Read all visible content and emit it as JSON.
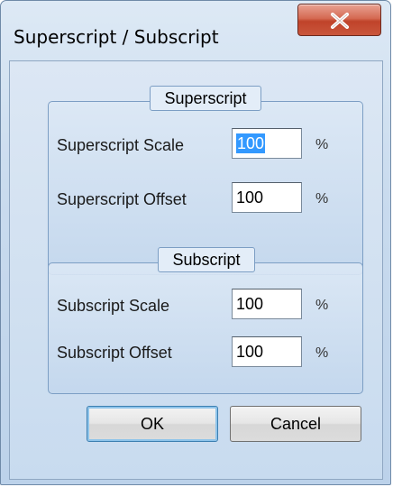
{
  "window": {
    "title": "Superscript / Subscript",
    "close_glyph": "X"
  },
  "superscript_group": {
    "label": "Superscript",
    "scale_label": "Superscript Scale",
    "scale_value": "100",
    "offset_label": "Superscript Offset",
    "offset_value": "100",
    "unit": "%"
  },
  "subscript_group": {
    "label": "Subscript",
    "scale_label": "Subscript Scale",
    "scale_value": "100",
    "offset_label": "Subscript Offset",
    "offset_value": "100",
    "unit": "%"
  },
  "buttons": {
    "ok_label": "OK",
    "cancel_label": "Cancel"
  },
  "colors": {
    "selection": "#3399ff",
    "close_button": "#c9563c"
  },
  "icons": {
    "close": "close-icon"
  }
}
